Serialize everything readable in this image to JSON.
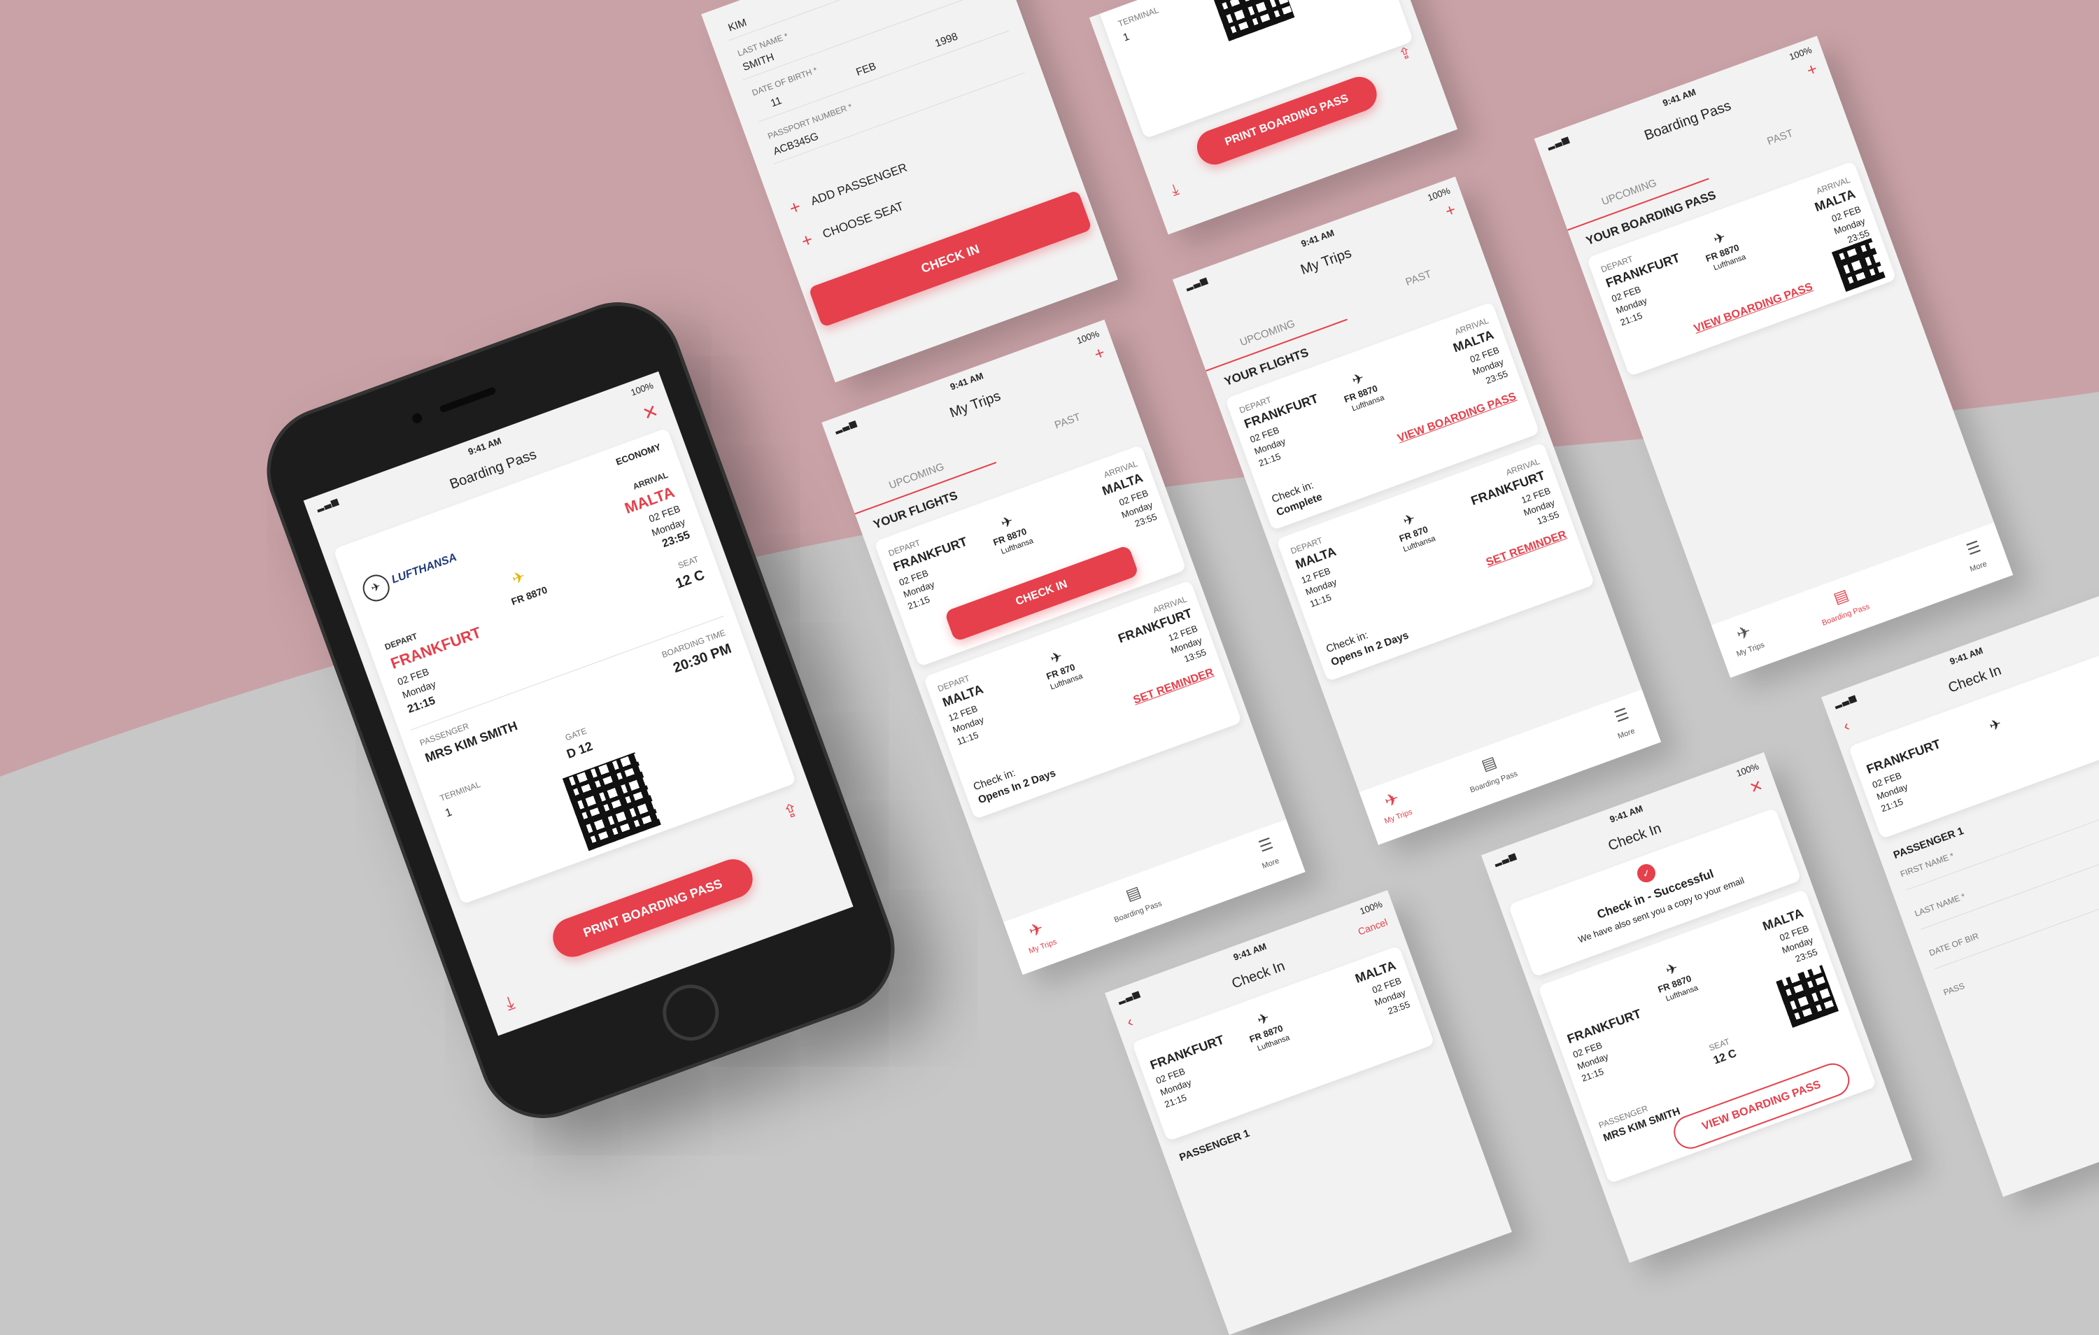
{
  "colors": {
    "accent": "#e5404b",
    "pink_bg": "#c9a2a7",
    "grey_bg": "#c7c7c7",
    "screen_bg": "#f2f2f2"
  },
  "status": {
    "time": "9:41 AM",
    "battery": "100%"
  },
  "phone": {
    "title": "Boarding Pass",
    "class": "ECONOMY",
    "airline": "LUFTHANSA",
    "depart_label": "DEPART",
    "depart_city": "FRANKFURT",
    "depart_date": "02 FEB",
    "depart_day": "Monday",
    "depart_time": "21:15",
    "arrival_label": "ARRIVAL",
    "arrival_city": "MALTA",
    "arrival_date": "02 FEB",
    "arrival_day": "Monday",
    "arrival_time": "23:55",
    "flight": "FR 8870",
    "seat_label": "SEAT",
    "seat": "12 C",
    "passenger_label": "PASSENGER",
    "passenger": "MRS KIM SMITH",
    "boarding_label": "BOARDING TIME",
    "boarding_time": "20:30 PM",
    "gate_label": "GATE",
    "gate": "D 12",
    "terminal_label": "TERMINAL",
    "terminal": "1",
    "print_button": "PRINT BOARDING PASS"
  },
  "form_screen": {
    "first_value": "KIM",
    "last_label": "LAST NAME *",
    "last_value": "SMITH",
    "dob_label": "DATE OF BIRTH *",
    "dob_day": "11",
    "dob_month": "FEB",
    "dob_year": "1998",
    "passport_label": "PASSPORT NUMBER *",
    "passport_value": "ACB345G",
    "add_passenger": "ADD PASSENGER",
    "choose_seat": "CHOOSE SEAT",
    "check_in": "CHECK IN"
  },
  "print_screen": {
    "terminal_label": "TERMINAL",
    "terminal": "1",
    "print_button": "PRINT BOARDING PASS"
  },
  "trips_a": {
    "title": "My Trips",
    "tab_upcoming": "UPCOMING",
    "tab_past": "PAST",
    "section": "YOUR FLIGHTS",
    "f1": {
      "depart": "DEPART",
      "from": "FRANKFURT",
      "date": "02 FEB",
      "day": "Monday",
      "time": "21:15",
      "flight": "FR 8870",
      "airline": "Lufthansa",
      "arrival": "ARRIVAL",
      "to": "MALTA",
      "adate": "02 FEB",
      "aday": "Monday",
      "atime": "23:55"
    },
    "check_in": "CHECK IN",
    "f2": {
      "depart": "DEPART",
      "from": "MALTA",
      "date": "12 FEB",
      "day": "Monday",
      "time": "11:15",
      "flight": "FR 870",
      "airline": "Lufthansa",
      "arrival": "ARRIVAL",
      "to": "FRANKFURT",
      "adate": "12 FEB",
      "aday": "Monday",
      "atime": "13:55"
    },
    "reminder": "SET REMINDER",
    "checkin_label": "Check in:",
    "checkin_status": "Opens In 2 Days",
    "tab_trips": "My Trips",
    "tab_pass": "Boarding Pass",
    "tab_more": "More"
  },
  "trips_b": {
    "title": "My Trips",
    "tab_upcoming": "UPCOMING",
    "tab_past": "PAST",
    "section": "YOUR FLIGHTS",
    "view_pass": "VIEW BOARDING PASS",
    "checkin_label": "Check in:",
    "checkin_done": "Complete",
    "reminder": "SET REMINDER",
    "checkin_status": "Opens In 2 Days",
    "tab_trips": "My Trips",
    "tab_pass": "Boarding Pass",
    "tab_more": "More"
  },
  "pass_list": {
    "title": "Boarding Pass",
    "tab_upcoming": "UPCOMING",
    "tab_past": "PAST",
    "section": "YOUR BOARDING PASS",
    "view_pass": "VIEW BOARDING PASS",
    "tab_trips": "My Trips",
    "tab_pass": "Boarding Pass",
    "tab_more": "More"
  },
  "checkin_success": {
    "title": "Check In",
    "success": "Check in - Successful",
    "note": "We have also sent you a copy to your email",
    "seat_label": "SEAT",
    "seat": "12 C",
    "passenger_label": "PASSENGER",
    "passenger": "MRS KIM SMITH",
    "view_pass": "VIEW BOARDING PASS"
  },
  "checkin_form": {
    "title": "Check In",
    "cancel": "Cancel",
    "passenger": "PASSENGER 1"
  },
  "checkin_edge": {
    "title": "Check In",
    "passenger": "PASSENGER 1",
    "first": "FIRST NAME *",
    "last": "LAST NAME *",
    "dob": "DATE OF BIR",
    "pass": "PASS"
  }
}
